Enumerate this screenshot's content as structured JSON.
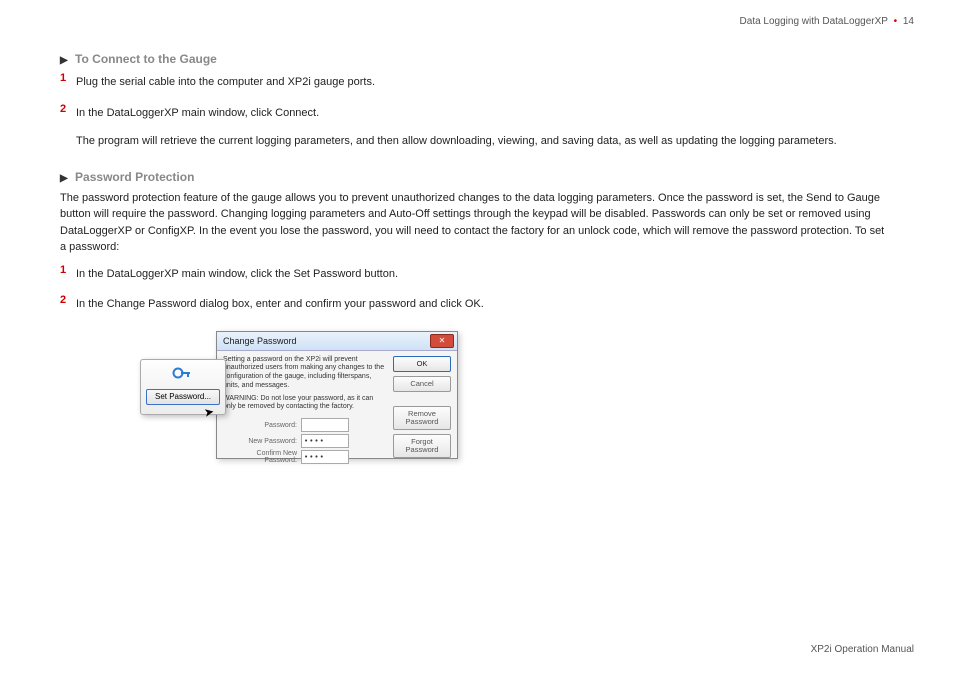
{
  "header": {
    "section": "Data Logging with DataLoggerXP",
    "page_num": "14"
  },
  "sections": {
    "connect": {
      "heading": "To Connect to the Gauge",
      "step1": "Plug the serial cable into the computer and XP2i gauge ports.",
      "step2": "In the DataLoggerXP main window, click Connect.",
      "detail": "The program will retrieve the current logging parameters, and then allow downloading, viewing, and saving data, as well as updating the logging parameters."
    },
    "password": {
      "heading": "Password Protection",
      "intro": "The password protection feature of the gauge allows you to prevent unauthorized changes to the data logging parameters. Once the password is set, the Send to Gauge button will require the password. Changing logging parameters and Auto-Off settings through the keypad will be disabled. Passwords can only be set or removed using DataLoggerXP or ConfigXP. In the event you lose the password, you will need to contact the factory for an unlock code, which will remove the password protection. To set a password:",
      "step1": "In the DataLoggerXP main window, click the Set Password button.",
      "step2": "In the Change Password dialog box, enter and confirm your password and click OK."
    }
  },
  "popup": {
    "button": "Set Password..."
  },
  "dialog": {
    "title": "Change Password",
    "msg": "Setting a password on the XP2i will prevent unauthorized users from making any changes to the configuration of the gauge, including filterspans, units, and messages.",
    "warn": "WARNING: Do not lose your password, as it can only be removed by contacting the factory.",
    "labels": {
      "old": "Password:",
      "new": "New Password:",
      "confirm": "Confirm New Password:"
    },
    "values": {
      "old": "",
      "new": "••••",
      "confirm": "••••"
    },
    "buttons": {
      "ok": "OK",
      "cancel": "Cancel",
      "remove": "Remove Password",
      "forgot": "Forgot Password"
    }
  },
  "footer": "XP2i Operation Manual"
}
